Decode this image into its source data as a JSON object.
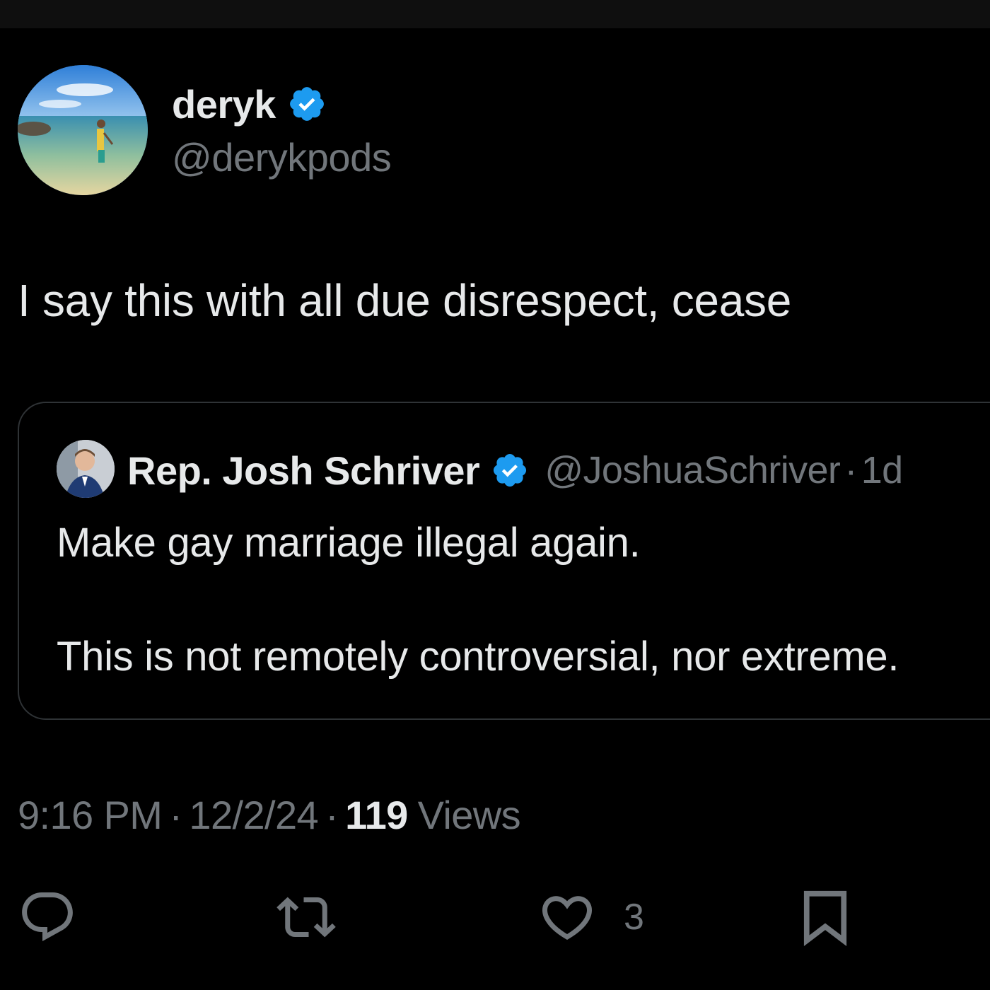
{
  "tweet": {
    "author": {
      "display_name": "deryk",
      "handle": "@derykpods",
      "verified": true
    },
    "text": "I say this with all due disrespect, cease",
    "timestamp": "9:16 PM",
    "date": "12/2/24",
    "separator": "·",
    "views_count": "119",
    "views_label": "Views"
  },
  "quote": {
    "author": {
      "display_name": "Rep. Josh Schriver",
      "handle": "@JoshuaSchriver",
      "verified": true
    },
    "age": "1d",
    "separator": "·",
    "text_line1": "Make gay marriage illegal again.",
    "text_line2": "This is not remotely controversial, nor extreme."
  },
  "actions": {
    "reply_icon": "reply-icon",
    "retweet_icon": "retweet-icon",
    "like_icon": "heart-icon",
    "like_count": "3",
    "bookmark_icon": "bookmark-icon"
  },
  "colors": {
    "background": "#000000",
    "primary_text": "#e7e9ea",
    "secondary_text": "#71767b",
    "verified_blue": "#1d9bf0",
    "border": "#2f3336"
  }
}
